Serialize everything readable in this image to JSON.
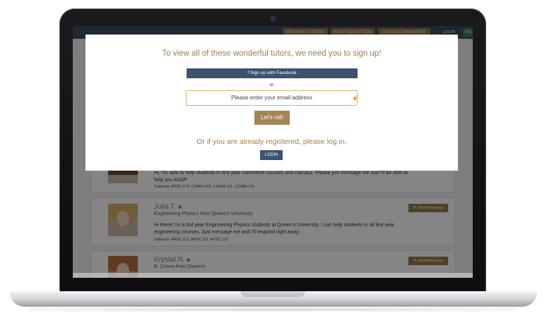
{
  "nav": {
    "browse": "BROWSE TUTORS",
    "post": "POST A QUESTION",
    "upload": "UPLOAD ASSIGMENT",
    "login": "LOGIN",
    "signup": "SIG"
  },
  "modal": {
    "heading": "To view all of these wonderful tutors, we need you to sign up!",
    "facebook_label": "f  Sign up with Facebook",
    "or": "or",
    "email_placeholder": "Please enter your email address",
    "submit_label": "Let's roll!",
    "already_registered": "Or if you are already registered, please log in.",
    "login_label": "LOGIN"
  },
  "tutors": [
    {
      "name": "",
      "program": "",
      "bio": "Hi, I'm able to help students in first year commerce courses and calculus. Please just message me and I'll be able to help you ASAP.",
      "subjects": "Subjects: APSC 174, COMM 103, COMM 111, COMM 131"
    },
    {
      "name": "Julia T.",
      "program": "Engineering Physics from Queen's University",
      "bio": "Hi there! I'm a 3rd year Engineering Physics students at Queen's University. I can help students in all first year engineering courses. Just message me and I'll respond right away.",
      "subjects": "Subjects: APSC 112, APSC 111, APSC 131",
      "send_label": "✉ Send Message"
    },
    {
      "name": "Krystal N.",
      "program": "B. Comm from Queen's",
      "send_label": "✉ Send Message"
    }
  ],
  "colors": {
    "accent_gold": "#a17c45",
    "button_navy": "#3d5170",
    "online_dot": "#78b546"
  }
}
